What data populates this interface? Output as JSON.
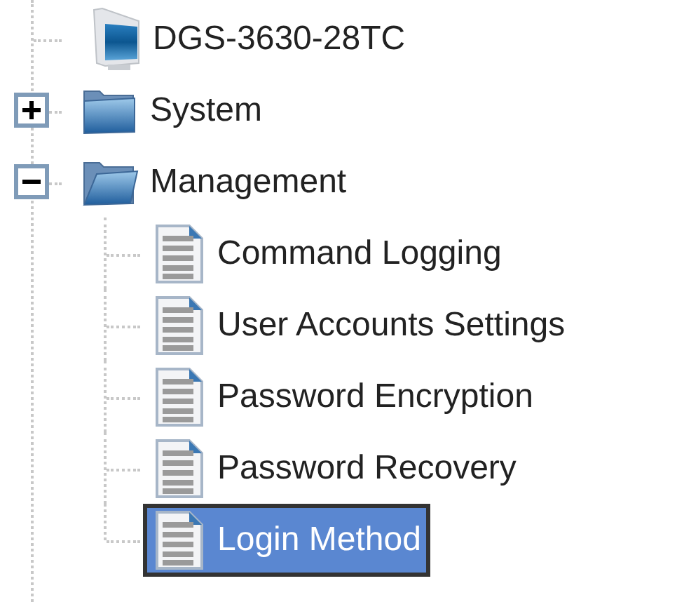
{
  "tree": [
    {
      "kind": "device",
      "label": "DGS-3630-28TC"
    },
    {
      "kind": "folder",
      "label": "System",
      "expanded": false
    },
    {
      "kind": "folder",
      "label": "Management",
      "expanded": true,
      "children": [
        {
          "label": "Command Logging",
          "selected": false
        },
        {
          "label": "User Accounts Settings",
          "selected": false
        },
        {
          "label": "Password Encryption",
          "selected": false
        },
        {
          "label": "Password Recovery",
          "selected": false
        },
        {
          "label": "Login Method",
          "selected": true
        }
      ]
    }
  ]
}
